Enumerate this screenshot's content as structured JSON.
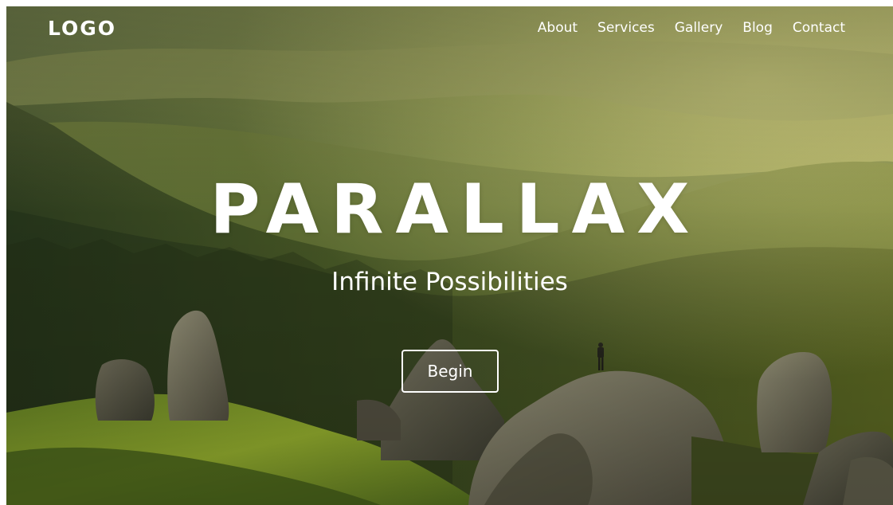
{
  "nav": {
    "logo": "LOGO",
    "links": [
      {
        "label": "About"
      },
      {
        "label": "Services"
      },
      {
        "label": "Gallery"
      },
      {
        "label": "Blog"
      },
      {
        "label": "Contact"
      }
    ]
  },
  "hero": {
    "title": "PARALLAX",
    "subtitle": "Infinite Possibilities",
    "cta_label": "Begin",
    "background": "mountain-forest-landscape-photo"
  },
  "colors": {
    "text": "#ffffff",
    "overlay_tint": "#6b7a2c",
    "forest_dark": "#2f3d1a",
    "rock": "#6f6a58",
    "grass_sunlit": "#8fa52e"
  }
}
